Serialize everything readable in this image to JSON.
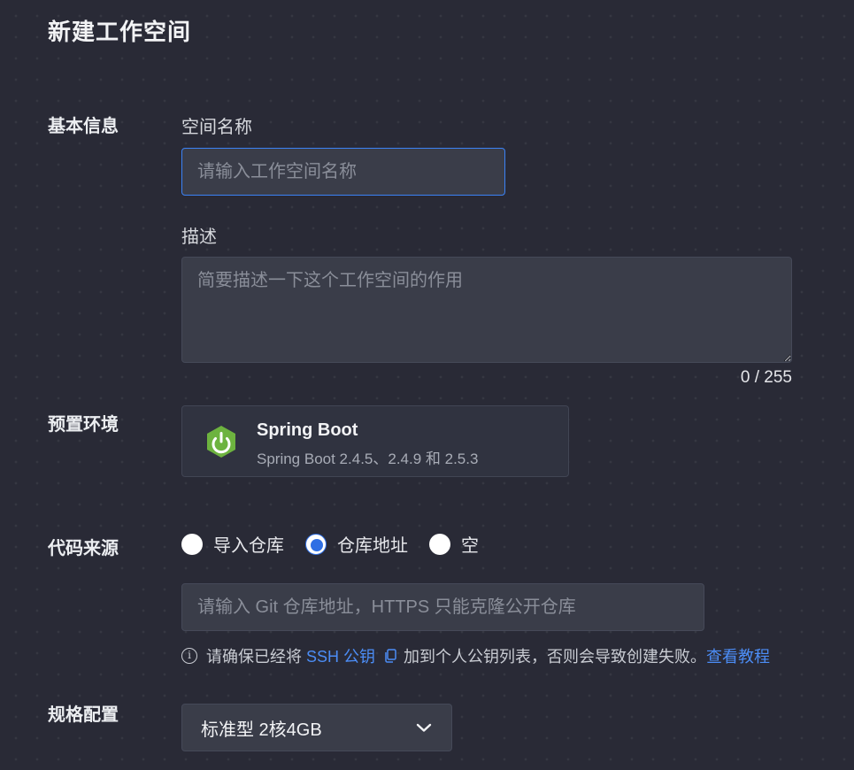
{
  "page": {
    "title": "新建工作空间"
  },
  "basic_info": {
    "section_label": "基本信息",
    "name_label": "空间名称",
    "name_placeholder": "请输入工作空间名称",
    "name_value": "",
    "desc_label": "描述",
    "desc_placeholder": "简要描述一下这个工作空间的作用",
    "desc_value": "",
    "desc_counter": "0 / 255"
  },
  "preset_env": {
    "section_label": "预置环境",
    "card": {
      "name": "Spring Boot",
      "versions": "Spring Boot 2.4.5、2.4.9 和 2.5.3",
      "icon": "spring-boot-power-icon",
      "icon_color": "#6db33f"
    }
  },
  "code_source": {
    "section_label": "代码来源",
    "options": [
      "导入仓库",
      "仓库地址",
      "空"
    ],
    "selected": "仓库地址",
    "repo_placeholder": "请输入 Git 仓库地址，HTTPS 只能克隆公开仓库",
    "repo_value": "",
    "hint_prefix": "请确保已经将",
    "hint_link": "SSH 公钥",
    "hint_suffix": "加到个人公钥列表，否则会导致创建失败。",
    "tutorial_link": "查看教程"
  },
  "spec": {
    "section_label": "规格配置",
    "selected": "标准型 2核4GB"
  },
  "colors": {
    "background": "#292a36",
    "accent": "#3b82f6",
    "link": "#4c8df6"
  }
}
